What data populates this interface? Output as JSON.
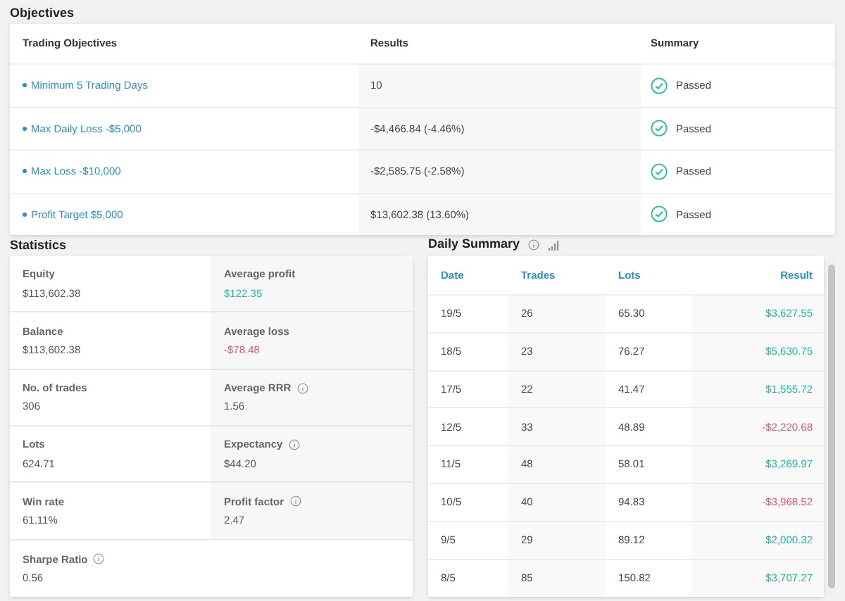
{
  "objectives": {
    "title": "Objectives",
    "columns": [
      "Trading Objectives",
      "Results",
      "Summary"
    ],
    "rows": [
      {
        "objective": "Minimum 5 Trading Days",
        "result": "10",
        "summary": "Passed",
        "passed": true
      },
      {
        "objective": "Max Daily Loss -$5,000",
        "result": "-$4,466.84 (-4.46%)",
        "summary": "Passed",
        "passed": true
      },
      {
        "objective": "Max Loss -$10,000",
        "result": "-$2,585.75 (-2.58%)",
        "summary": "Passed",
        "passed": true
      },
      {
        "objective": "Profit Target $5,000",
        "result": "$13,602.38 (13.60%)",
        "summary": "Passed",
        "passed": true
      }
    ]
  },
  "statistics": {
    "title": "Statistics",
    "items": [
      {
        "label": "Equity",
        "value": "$113,602.38",
        "kind": "neutral",
        "info": false
      },
      {
        "label": "Average profit",
        "value": "$122.35",
        "kind": "positive",
        "info": false
      },
      {
        "label": "Balance",
        "value": "$113,602.38",
        "kind": "neutral",
        "info": false
      },
      {
        "label": "Average loss",
        "value": "-$78.48",
        "kind": "negative",
        "info": false
      },
      {
        "label": "No. of trades",
        "value": "306",
        "kind": "neutral",
        "info": false
      },
      {
        "label": "Average RRR",
        "value": "1.56",
        "kind": "neutral",
        "info": true
      },
      {
        "label": "Lots",
        "value": "624.71",
        "kind": "neutral",
        "info": false
      },
      {
        "label": "Expectancy",
        "value": "$44.20",
        "kind": "neutral",
        "info": true
      },
      {
        "label": "Win rate",
        "value": "61.11%",
        "kind": "neutral",
        "info": false
      },
      {
        "label": "Profit factor",
        "value": "2.47",
        "kind": "neutral",
        "info": true
      },
      {
        "label": "Sharpe Ratio",
        "value": "0.56",
        "kind": "neutral",
        "info": true
      }
    ]
  },
  "daily_summary": {
    "title": "Daily Summary",
    "columns": [
      "Date",
      "Trades",
      "Lots",
      "Result"
    ],
    "rows": [
      {
        "date": "19/5",
        "trades": "26",
        "lots": "65.30",
        "result": "$3,627.55",
        "kind": "positive"
      },
      {
        "date": "18/5",
        "trades": "23",
        "lots": "76.27",
        "result": "$5,630.75",
        "kind": "positive"
      },
      {
        "date": "17/5",
        "trades": "22",
        "lots": "41.47",
        "result": "$1,555.72",
        "kind": "positive"
      },
      {
        "date": "12/5",
        "trades": "33",
        "lots": "48.89",
        "result": "-$2,220.68",
        "kind": "negative"
      },
      {
        "date": "11/5",
        "trades": "48",
        "lots": "58.01",
        "result": "$3,269.97",
        "kind": "positive"
      },
      {
        "date": "10/5",
        "trades": "40",
        "lots": "94.83",
        "result": "-$3,968.52",
        "kind": "negative"
      },
      {
        "date": "9/5",
        "trades": "29",
        "lots": "89.12",
        "result": "$2,000.32",
        "kind": "positive"
      },
      {
        "date": "8/5",
        "trades": "85",
        "lots": "150.82",
        "result": "$3,707.27",
        "kind": "positive"
      }
    ]
  }
}
